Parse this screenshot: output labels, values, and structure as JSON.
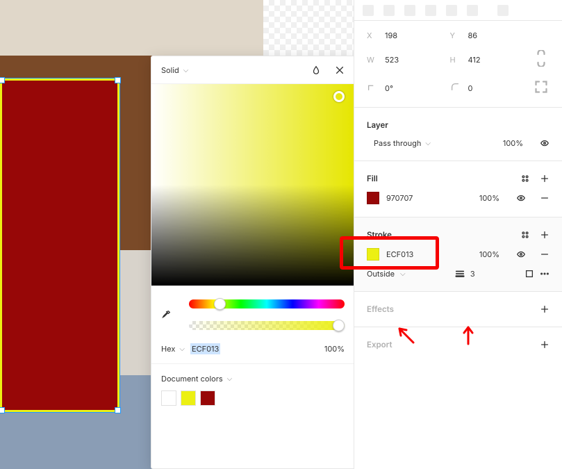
{
  "transform": {
    "x_label": "X",
    "x": "198",
    "y_label": "Y",
    "y": "86",
    "w_label": "W",
    "w": "523",
    "h_label": "H",
    "h": "412",
    "rotation": "0°",
    "corner_radius": "0"
  },
  "layer": {
    "title": "Layer",
    "blend_mode": "Pass through",
    "opacity": "100%"
  },
  "fill": {
    "title": "Fill",
    "hex": "970707",
    "opacity": "100%"
  },
  "stroke": {
    "title": "Stroke",
    "hex": "ECF013",
    "opacity": "100%",
    "position": "Outside",
    "weight": "3"
  },
  "effects": {
    "title": "Effects"
  },
  "export": {
    "title": "Export"
  },
  "picker": {
    "type": "Solid",
    "hex_label": "Hex",
    "hex": "ECF013",
    "opacity": "100%",
    "doc_colors_label": "Document colors",
    "doc_swatches": [
      "#ffffff",
      "#ecf013",
      "#970707"
    ]
  }
}
